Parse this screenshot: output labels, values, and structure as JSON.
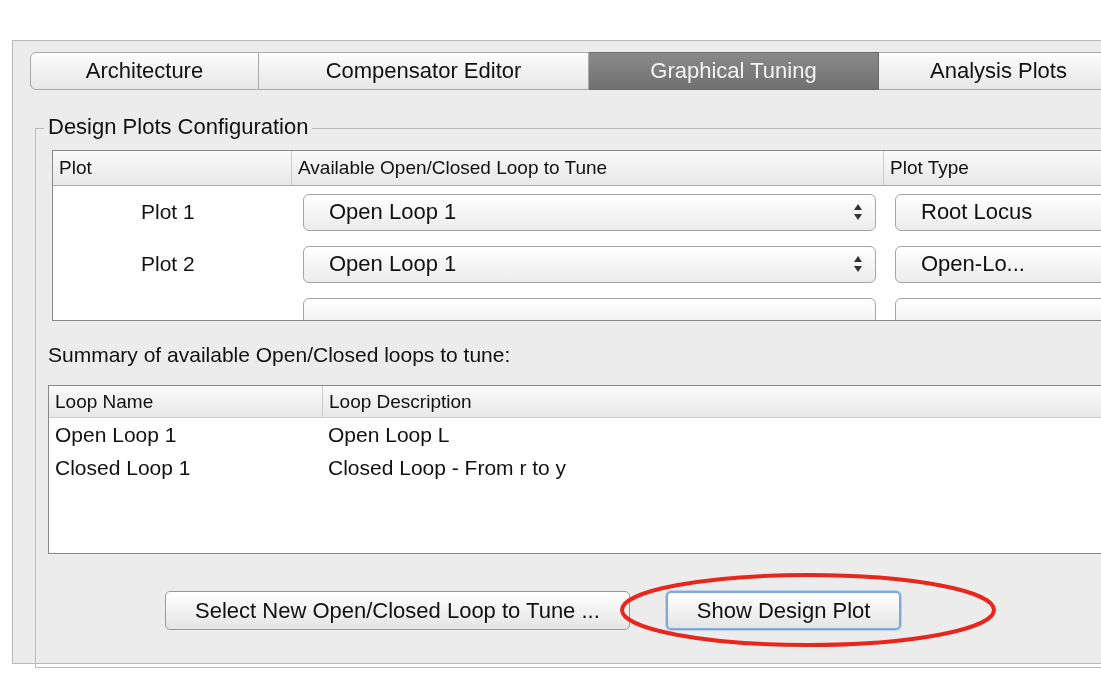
{
  "tabs": [
    {
      "label": "Architecture",
      "selected": false
    },
    {
      "label": "Compensator Editor",
      "selected": false
    },
    {
      "label": "Graphical Tuning",
      "selected": true
    },
    {
      "label": "Analysis Plots",
      "selected": false
    }
  ],
  "design_plots": {
    "title": "Design Plots Configuration",
    "columns": [
      "Plot",
      "Available Open/Closed Loop to Tune",
      "Plot Type"
    ],
    "rows": [
      {
        "plot": "Plot 1",
        "loop": "Open Loop 1",
        "plot_type": "Root Locus"
      },
      {
        "plot": "Plot 2",
        "loop": "Open Loop 1",
        "plot_type": "Open-Lo..."
      }
    ],
    "partial_row": true
  },
  "summary": {
    "label": "Summary of available Open/Closed loops to tune:",
    "columns": [
      "Loop Name",
      "Loop Description"
    ],
    "rows": [
      {
        "name": "Open Loop 1",
        "description": "Open Loop L"
      },
      {
        "name": "Closed Loop 1",
        "description": "Closed Loop - From r to y"
      }
    ]
  },
  "buttons": [
    {
      "label": "Select New Open/Closed Loop to Tune ...",
      "focused": false,
      "circled": false
    },
    {
      "label": "Show Design Plot",
      "focused": true,
      "circled": true
    }
  ]
}
